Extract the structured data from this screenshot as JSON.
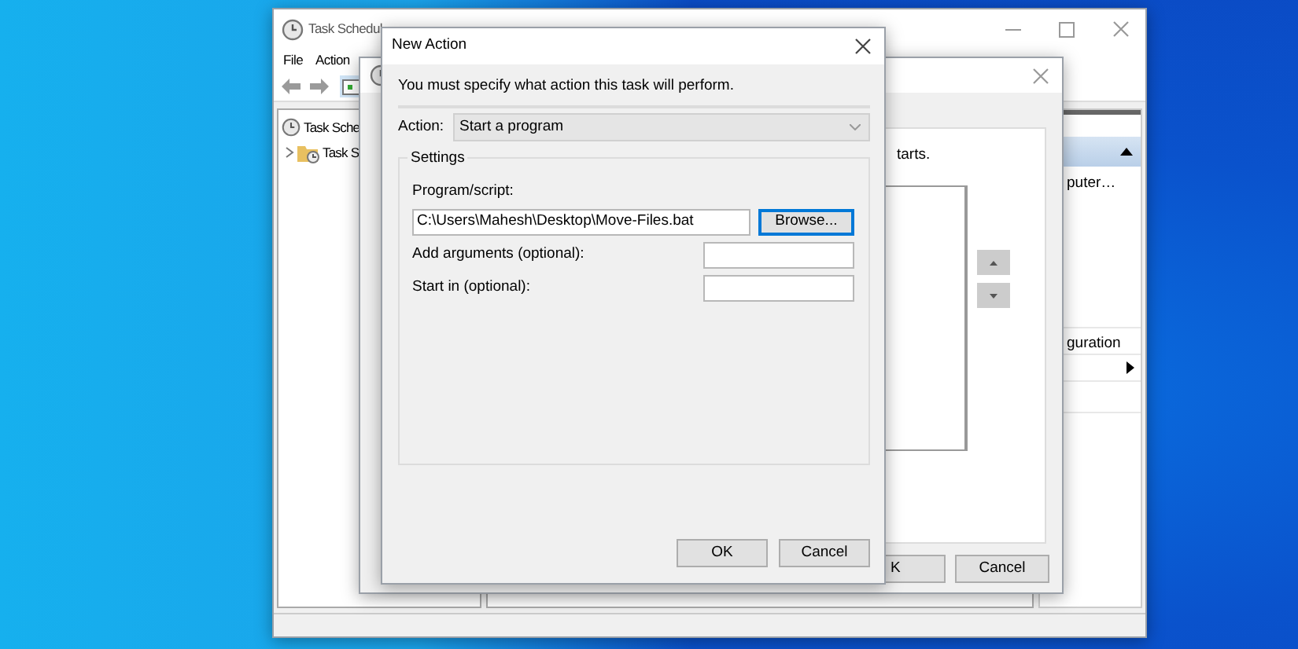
{
  "main_window": {
    "title": "Task Schedul",
    "menu": [
      "File",
      "Action"
    ],
    "tree": [
      {
        "label": "Task Sche",
        "children": [
          {
            "label": "Task S",
            "expanded": false
          }
        ]
      }
    ],
    "actions_pane": {
      "items": [
        "puter…",
        "guration"
      ]
    }
  },
  "create_task_dialog": {
    "text": "tarts.",
    "buttons": [
      "K",
      "Cancel"
    ]
  },
  "new_action_dialog": {
    "title": "New Action",
    "instruction": "You must specify what action this task will perform.",
    "action": {
      "label": "Action:",
      "value": "Start a program"
    },
    "settings": {
      "title": "Settings",
      "program": {
        "label": "Program/script:",
        "value": "C:\\Users\\Mahesh\\Desktop\\Move-Files.bat"
      },
      "browse_button": {
        "label": "Browse...",
        "focused": true
      },
      "fields": [
        {
          "label": "Add arguments (optional):"
        },
        {
          "label": "Start in (optional):"
        }
      ]
    },
    "buttons": [
      "OK",
      "Cancel"
    ]
  }
}
